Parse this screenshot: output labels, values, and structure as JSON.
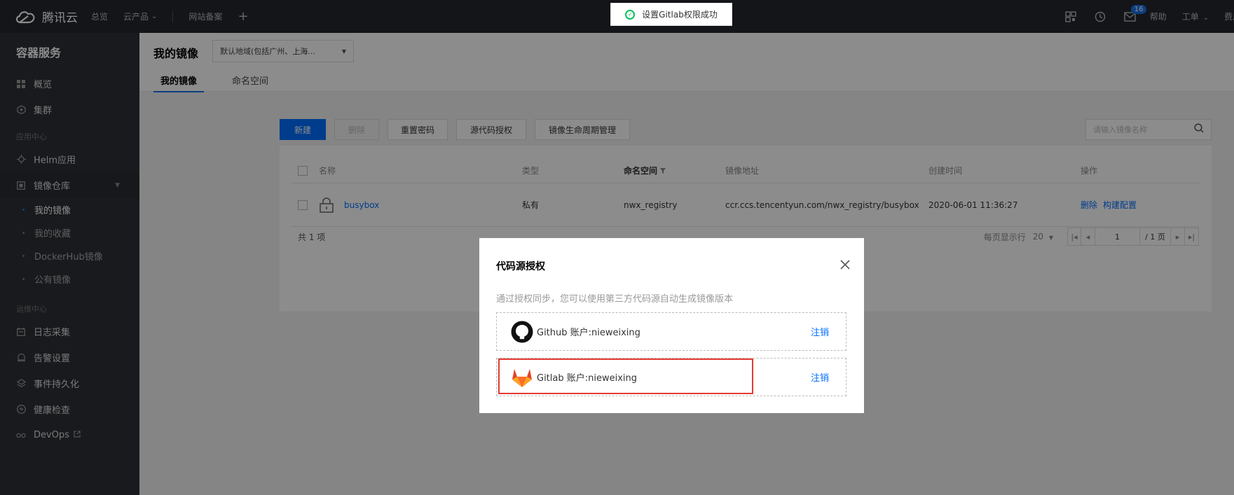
{
  "topbar": {
    "brand": "腾讯云",
    "nav": [
      "总览",
      "云产品",
      "网站备案"
    ],
    "nav_caret": "⌄",
    "plus": "+",
    "mail_count": "16",
    "help": "帮助",
    "ticket": "工单",
    "trailing": "费用"
  },
  "sidebar": {
    "title": "容器服务",
    "items_top": [
      {
        "label": "概览",
        "icon": "grid-icon"
      },
      {
        "label": "集群",
        "icon": "cluster-icon"
      }
    ],
    "group_app": "应用中心",
    "helm": "Helm应用",
    "registry": "镜像仓库",
    "sub": [
      "我的镜像",
      "我的收藏",
      "DockerHub镜像",
      "公有镜像"
    ],
    "group_ops": "运维中心",
    "ops": [
      {
        "label": "日志采集",
        "icon": "log-icon"
      },
      {
        "label": "告警设置",
        "icon": "alarm-icon"
      },
      {
        "label": "事件持久化",
        "icon": "layers-icon"
      },
      {
        "label": "健康检查",
        "icon": "health-icon"
      },
      {
        "label": "DevOps",
        "icon": "devops-icon"
      }
    ]
  },
  "header": {
    "title": "我的镜像",
    "region": "默认地域(包括广州、上海...",
    "tabs": [
      "我的镜像",
      "命名空间"
    ]
  },
  "toolbar": {
    "new": "新建",
    "delete": "删除",
    "reset_pwd": "重置密码",
    "source_auth": "源代码授权",
    "lifecycle": "镜像生命周期管理",
    "search_placeholder": "请输入镜像名称"
  },
  "table": {
    "headers": [
      "名称",
      "类型",
      "命名空间",
      "镜像地址",
      "创建时间",
      "操作"
    ],
    "rows": [
      {
        "name": "busybox",
        "type": "私有",
        "namespace": "nwx_registry",
        "address": "ccr.ccs.tencentyun.com/nwx_registry/busybox",
        "created": "2020-06-01 11:36:27",
        "actions": [
          "删除",
          "构建配置"
        ]
      }
    ],
    "total": "共 1 项",
    "per_page_label": "每页显示行",
    "per_page": "20",
    "page": "1",
    "page_total": "/ 1 页"
  },
  "toast": {
    "text": "设置Gitlab权限成功"
  },
  "dialog": {
    "title": "代码源授权",
    "desc": "通过授权同步，您可以使用第三方代码源自动生成镜像版本",
    "accounts": [
      {
        "label": "Github 账户:nieweixing",
        "action": "注销",
        "icon": "github-icon"
      },
      {
        "label": "Gitlab 账户:nieweixing",
        "action": "注销",
        "icon": "gitlab-icon"
      }
    ]
  },
  "colors": {
    "accent": "#006eff",
    "highlight": "#e53935",
    "success": "#0abf5b"
  }
}
